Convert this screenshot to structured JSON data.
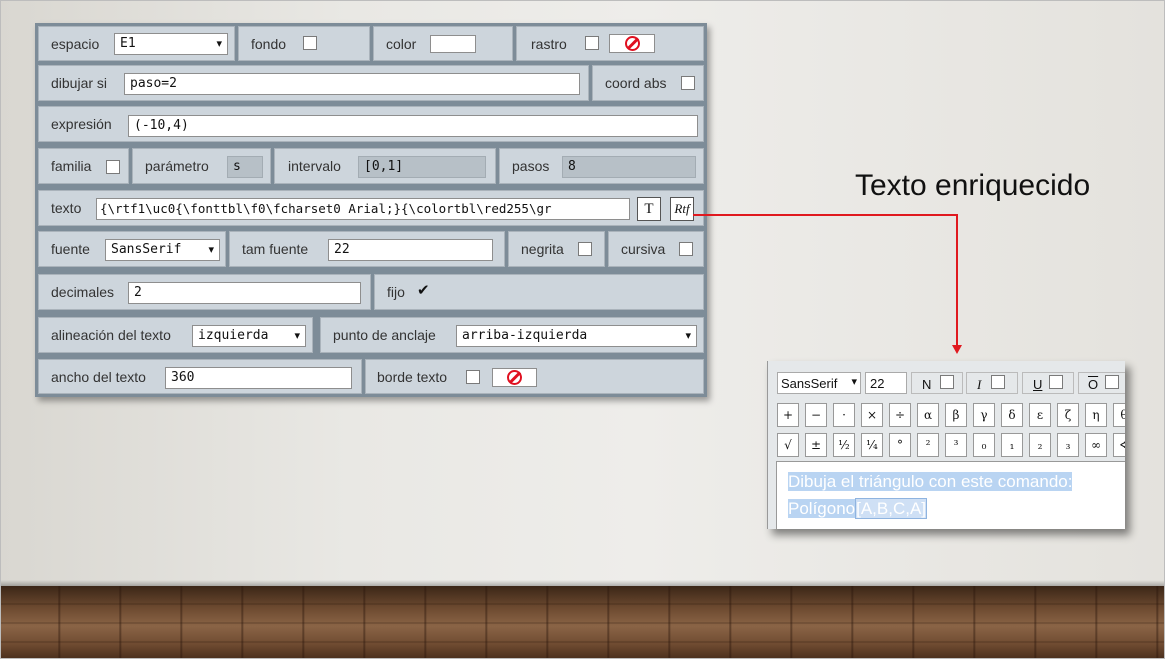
{
  "form": {
    "espacio_label": "espacio",
    "espacio_value": "E1",
    "fondo_label": "fondo",
    "color_label": "color",
    "rastro_label": "rastro",
    "dibujar_si_label": "dibujar si",
    "dibujar_si_value": "paso=2",
    "coord_abs_label": "coord abs",
    "expresion_label": "expresión",
    "expresion_value": "(-10,4)",
    "familia_label": "familia",
    "parametro_label": "parámetro",
    "parametro_value": "s",
    "intervalo_label": "intervalo",
    "intervalo_value": "[0,1]",
    "pasos_label": "pasos",
    "pasos_value": "8",
    "texto_label": "texto",
    "texto_value": "{\\rtf1\\uc0{\\fonttbl\\f0\\fcharset0 Arial;}{\\colortbl\\red255\\gr",
    "texto_t_button": "T",
    "texto_rtf_button": "Rtf",
    "fuente_label": "fuente",
    "fuente_value": "SansSerif",
    "tam_fuente_label": "tam fuente",
    "tam_fuente_value": "22",
    "negrita_label": "negrita",
    "cursiva_label": "cursiva",
    "decimales_label": "decimales",
    "decimales_value": "2",
    "fijo_label": "fijo",
    "alineacion_label": "alineación del texto",
    "alineacion_value": "izquierda",
    "anclaje_label": "punto de anclaje",
    "anclaje_value": "arriba-izquierda",
    "ancho_label": "ancho del texto",
    "ancho_value": "360",
    "borde_label": "borde texto"
  },
  "annotation": {
    "title": "Texto enriquecido",
    "arrow_color": "#e0191f"
  },
  "rich_text_editor": {
    "font_value": "SansSerif",
    "size_value": "22",
    "bold_label": "N",
    "italic_label": "I",
    "underline_label": "U",
    "overline_label": "O",
    "symbols_row1": [
      "+",
      "−",
      "·",
      "×",
      "÷",
      "α",
      "β",
      "γ",
      "δ",
      "ε",
      "ζ",
      "η",
      "θ"
    ],
    "symbols_row2": [
      "√",
      "±",
      "½",
      "¼",
      "°",
      "²",
      "³",
      "₀",
      "₁",
      "₂",
      "₃",
      "∞",
      "∢"
    ],
    "content_line1": "Dibuja el triángulo con este comando:",
    "content_line2_a": " Polígono",
    "content_line2_b": "[A,B,C,A]",
    "selection_color": "#b9d4f2"
  }
}
